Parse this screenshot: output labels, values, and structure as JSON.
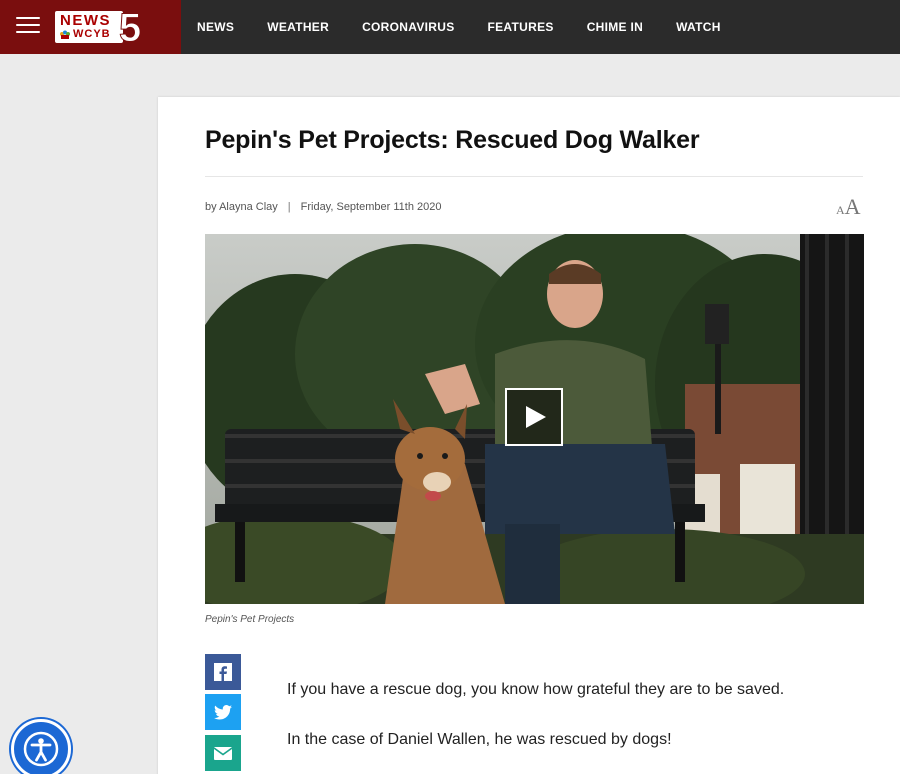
{
  "header": {
    "menu_icon": "hamburger-menu-icon",
    "logo": {
      "word": "NEWS",
      "call_letters": "WCYB",
      "channel": "5"
    },
    "nav": [
      {
        "label": "NEWS"
      },
      {
        "label": "WEATHER"
      },
      {
        "label": "CORONAVIRUS"
      },
      {
        "label": "FEATURES"
      },
      {
        "label": "CHIME IN"
      },
      {
        "label": "WATCH"
      }
    ]
  },
  "article": {
    "title": "Pepin's Pet Projects: Rescued Dog Walker",
    "byline": {
      "author": "by Alayna Clay",
      "separator": "|",
      "date": "Friday, September 11th 2020"
    },
    "font_size_control": {
      "small": "A",
      "large": "A"
    },
    "video": {
      "play_icon": "play-icon",
      "caption": "Pepin's Pet Projects"
    },
    "share": [
      {
        "name": "facebook",
        "icon": "facebook-icon",
        "color": "#3b5998"
      },
      {
        "name": "twitter",
        "icon": "twitter-icon",
        "color": "#1da1f2"
      },
      {
        "name": "email",
        "icon": "email-icon",
        "color": "#1aa58d"
      }
    ],
    "paragraphs": [
      "If you have a rescue dog, you know how grateful they are to be saved.",
      "In the case of Daniel Wallen, he was rescued by dogs!"
    ]
  },
  "accessibility": {
    "icon": "accessibility-icon",
    "color": "#1c68d4"
  },
  "colors": {
    "brand": "#7a0e0e",
    "topbar": "#2b2b2b",
    "page_bg": "#ebebeb"
  }
}
